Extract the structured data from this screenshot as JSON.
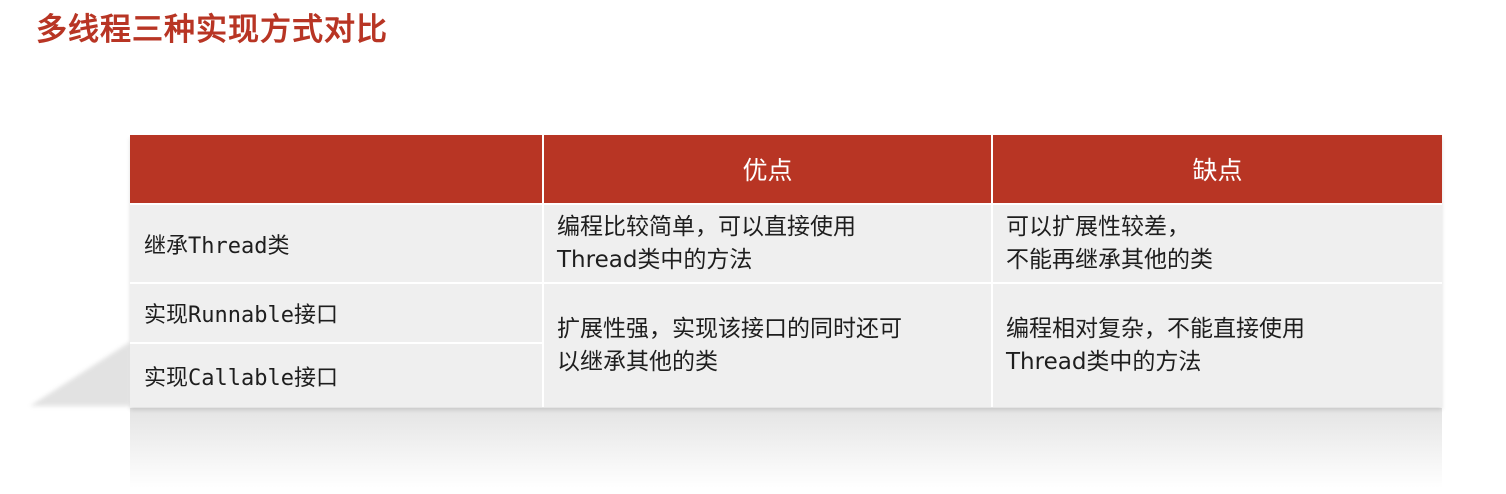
{
  "page": {
    "title": "多线程三种实现方式对比"
  },
  "table": {
    "headers": [
      "",
      "优点",
      "缺点"
    ],
    "rows": [
      {
        "label": "继承Thread类",
        "pros": "编程比较简单，可以直接使用\nThread类中的方法",
        "cons": "可以扩展性较差，\n不能再继承其他的类"
      },
      {
        "label": "实现Runnable接口"
      },
      {
        "label": "实现Callable接口"
      }
    ],
    "merged": {
      "pros": "扩展性强，实现该接口的同时还可\n以继承其他的类",
      "cons": "编程相对复杂，不能直接使用\nThread类中的方法"
    }
  },
  "colors": {
    "accent": "#b83524",
    "cell_bg": "#efefef",
    "text": "#1e1e1e"
  }
}
